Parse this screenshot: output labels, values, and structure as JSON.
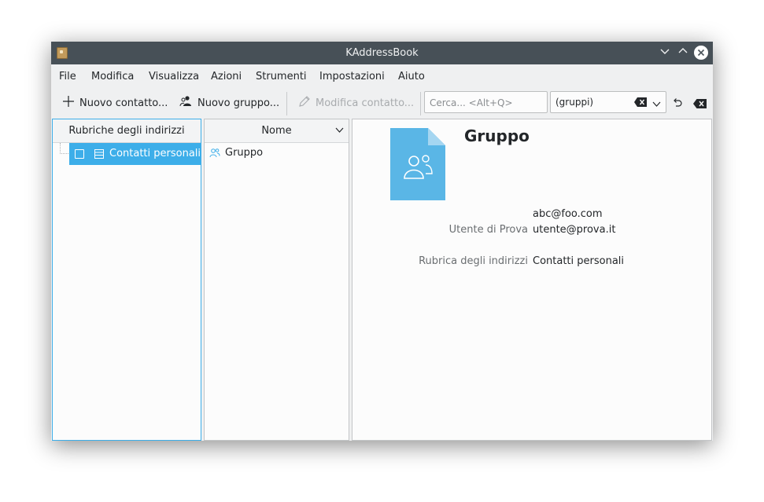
{
  "window": {
    "title": "KAddressBook"
  },
  "titlebar_buttons": {
    "minimize": "minimize-icon",
    "maximize": "maximize-icon",
    "close": "close-icon"
  },
  "menu": {
    "items": [
      "File",
      "Modifica",
      "Visualizza",
      "Azioni",
      "Strumenti",
      "Impostazioni",
      "Aiuto"
    ]
  },
  "toolbar": {
    "new_contact": "Nuovo contatto...",
    "new_group": "Nuovo gruppo...",
    "edit_contact": "Modifica contatto...",
    "search_placeholder": "Cerca... <Alt+Q>",
    "search_value": "",
    "filter_value": "(gruppi)"
  },
  "address_books": {
    "header": "Rubriche degli indirizzi",
    "items": [
      {
        "label": "Contatti personali",
        "checked": false,
        "selected": true
      }
    ]
  },
  "contact_list": {
    "header": "Nome",
    "items": [
      {
        "label": "Gruppo",
        "icon": "group-icon"
      }
    ]
  },
  "details": {
    "name": "Gruppo",
    "members": [
      {
        "label": "",
        "value": "abc@foo.com"
      },
      {
        "label": "Utente di Prova",
        "value": "utente@prova.it"
      }
    ],
    "address_book_label": "Rubrica degli indirizzi",
    "address_book_value": "Contatti personali"
  },
  "colors": {
    "titlebar": "#475057",
    "accent": "#3daee9",
    "window_bg": "#eff0f1",
    "view_bg": "#fcfcfc"
  }
}
